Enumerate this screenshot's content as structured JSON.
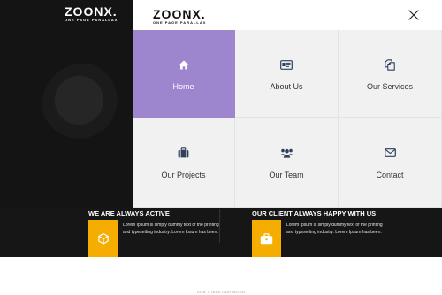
{
  "background_page": {
    "logo": {
      "name": "ZOONX.",
      "tagline": "ONE PAGE PARALLAX"
    },
    "features": [
      {
        "title": "WE ARE ALWAYS ACTIVE",
        "text": "Lorem Ipsum is simply dummy text of the printing and typesetting industry. Lorem Ipsum has been.",
        "icon": "cube-icon"
      },
      {
        "title": "OUR CLIENT ALWAYS HAPPY WITH US",
        "text": "Lorem Ipsum is simply dummy text of the printing and typesetting industry. Lorem Ipsum has been.",
        "icon": "briefcase-icon"
      }
    ],
    "section_label": "DON'T TAKE OUR WORD"
  },
  "menu": {
    "logo": {
      "name": "ZOONX.",
      "tagline": "ONE PAGE PARALLAX"
    },
    "close_icon": "close-icon",
    "items": [
      {
        "label": "Home",
        "icon": "home-icon",
        "active": true
      },
      {
        "label": "About Us",
        "icon": "id-card-icon",
        "active": false
      },
      {
        "label": "Our Services",
        "icon": "copy-icon",
        "active": false
      },
      {
        "label": "Our Projects",
        "icon": "briefcase-icon",
        "active": false
      },
      {
        "label": "Our Team",
        "icon": "users-icon",
        "active": false
      },
      {
        "label": "Contact",
        "icon": "envelope-icon",
        "active": false
      }
    ]
  },
  "colors": {
    "active_tile": "#9e86cf",
    "tile": "#f1f1f1",
    "icon": "#2f3f5c",
    "feature_accent": "#f5ad00",
    "dark_bg": "#141414"
  }
}
